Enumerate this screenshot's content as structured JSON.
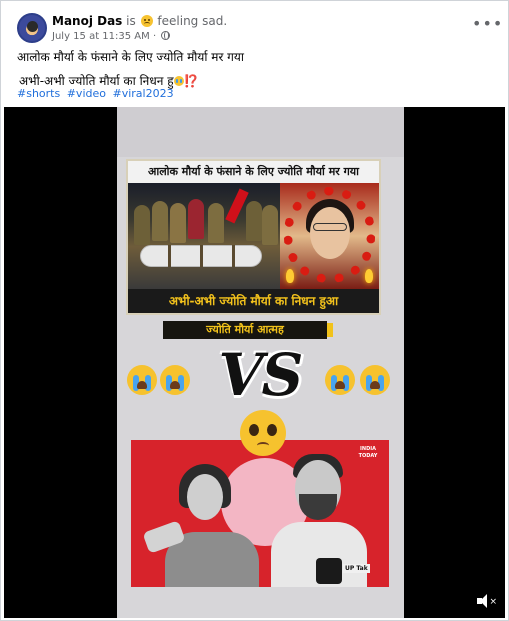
{
  "post": {
    "author": "Manoj Das",
    "status_is": "is",
    "feeling": "feeling sad.",
    "timestamp": "July 15 at 11:35 AM",
    "separator": "·",
    "more_icon": "ellipsis-icon",
    "text_line1": "आलोक मौर्या के फंसाने के लिए ज्योति मौर्या मर गया",
    "text_line2": "अभी-अभी ज्योति मौर्या का निधन हु",
    "text_line2_tail": "⁉️",
    "hashtags": [
      "#shorts",
      "#video",
      "#viral2023"
    ]
  },
  "video": {
    "thumb1_title": "आलोक मौर्या के फंसाने के लिए ज्योति मौर्या मर गया",
    "thumb1_caption": "अभी-अभी ज्योति मौर्या का निधन हुआ",
    "subtitle": "ज्योति मौर्या आत्मह",
    "vs_text": "VS",
    "logo": "INDIA TODAY",
    "mic_label": "UP Tak",
    "volume_icon": "muted-speaker-icon"
  },
  "colors": {
    "link": "#216fdb",
    "muted_text": "#65676b",
    "caption_yellow": "#f3c21c",
    "thumb2_red": "#d7232b"
  }
}
